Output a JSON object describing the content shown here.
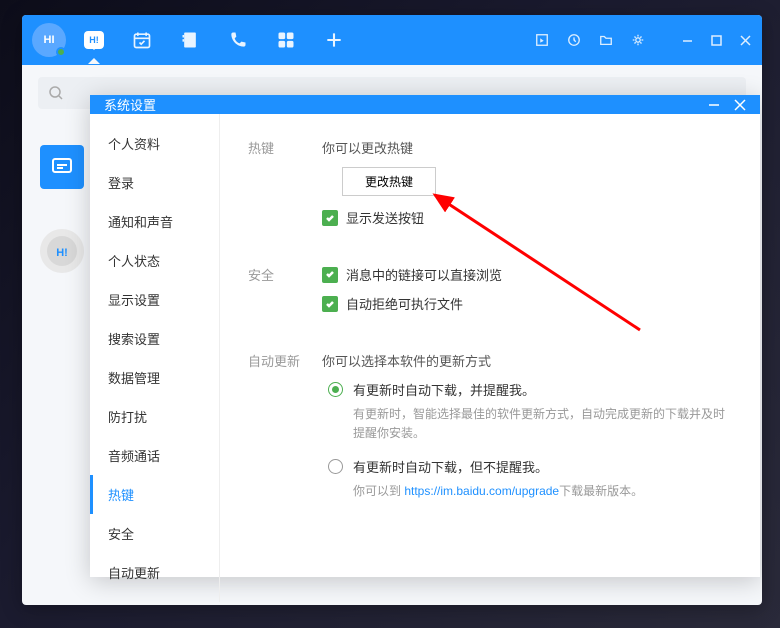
{
  "avatar": {
    "text": "HI"
  },
  "nav": {
    "bubble": "H!"
  },
  "dialog": {
    "title": "系统设置",
    "sidebar": {
      "items": [
        {
          "label": "个人资料"
        },
        {
          "label": "登录"
        },
        {
          "label": "通知和声音"
        },
        {
          "label": "个人状态"
        },
        {
          "label": "显示设置"
        },
        {
          "label": "搜索设置"
        },
        {
          "label": "数据管理"
        },
        {
          "label": "防打扰"
        },
        {
          "label": "音频通话"
        },
        {
          "label": "热键"
        },
        {
          "label": "安全"
        },
        {
          "label": "自动更新"
        }
      ],
      "active_index": 9
    },
    "sections": {
      "hotkey": {
        "label": "热键",
        "help": "你可以更改热键",
        "button": "更改热键",
        "checkbox1": "显示发送按钮"
      },
      "security": {
        "label": "安全",
        "checkbox1": "消息中的链接可以直接浏览",
        "checkbox2": "自动拒绝可执行文件"
      },
      "update": {
        "label": "自动更新",
        "help": "你可以选择本软件的更新方式",
        "option1": "有更新时自动下载，并提醒我。",
        "option1_desc": "有更新时，智能选择最佳的软件更新方式，自动完成更新的下载并及时提醒你安装。",
        "option2": "有更新时自动下载，但不提醒我。",
        "option2_prefix": "你可以到 ",
        "option2_link": "https://im.baidu.com/upgrade",
        "option2_suffix": "下载最新版本。"
      }
    }
  }
}
